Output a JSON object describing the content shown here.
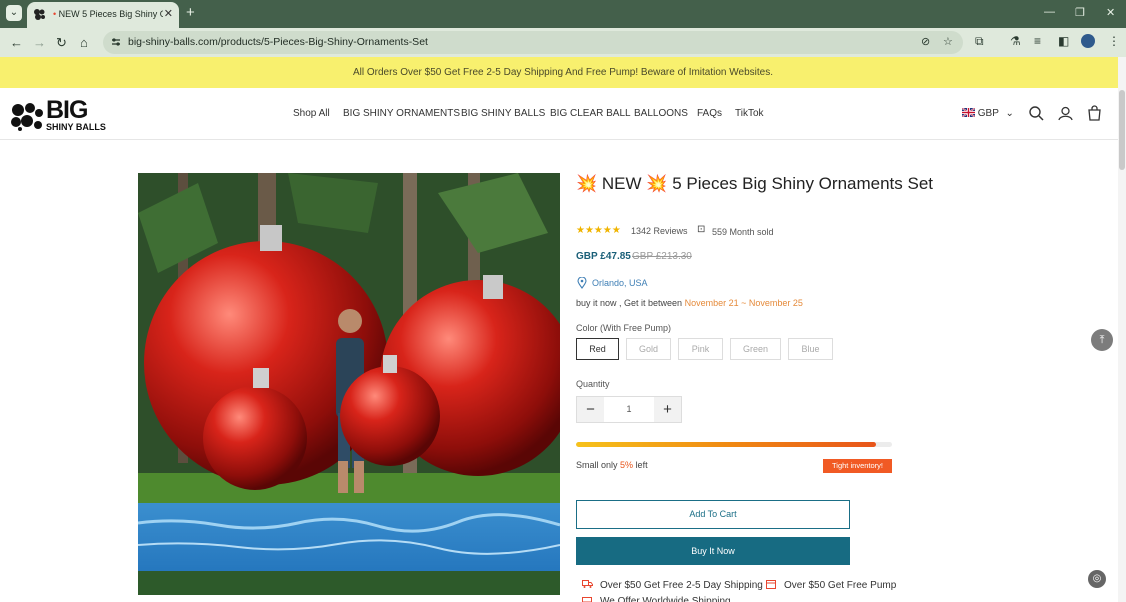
{
  "browser": {
    "tab_title": "NEW 5 Pieces Big Shiny O",
    "tab_prefix": "•",
    "url": "big-shiny-balls.com/products/5-Pieces-Big-Shiny-Ornaments-Set",
    "new_tab": "+",
    "close_tab": "✕",
    "minimize": "—",
    "maximize": "❐",
    "close_window": "✕"
  },
  "announcement": "All Orders Over $50 Get Free 2-5 Day Shipping And Free Pump! Beware of Imitation Websites.",
  "logo": {
    "big": "BIG",
    "sub": "SHINY BALLS"
  },
  "nav": [
    "Shop All",
    "BIG SHINY ORNAMENTS",
    "BIG SHINY BALLS",
    "BIG CLEAR BALL",
    "BALLOONS",
    "FAQs",
    "TikTok"
  ],
  "currency": "GBP",
  "product": {
    "burst": "💥",
    "title_mid": "NEW",
    "title_rest": "5 Pieces Big Shiny Ornaments Set",
    "rating_stars": "★★★★★",
    "rating": 5,
    "reviews": "1342 Reviews",
    "sold": "559 Month sold",
    "price": "GBP £47.85",
    "old_price": "GBP £213.30",
    "location": "Orlando, USA",
    "delivery_prefix": "buy it now ,  Get it between",
    "delivery_dates": "November 21 ~ November 25",
    "color_label": "Color (With Free Pump)",
    "colors": [
      "Red",
      "Gold",
      "Pink",
      "Green",
      "Blue"
    ],
    "selected_color": "Red",
    "quantity_label": "Quantity",
    "quantity": "1",
    "minus": "−",
    "plus": "+",
    "stock_fraction": 0.95,
    "stock_text_prefix": "Small  only",
    "stock_pct": "5%",
    "stock_suffix": "left",
    "tight_inventory": "Tight inventory!",
    "add_to_cart": "Add To Cart",
    "buy_now": "Buy It Now",
    "perks": [
      "Over $50 Get Free 2-5 Day Shipping",
      "Over $50 Get Free Pump",
      "We Offer Worldwide Shipping"
    ]
  },
  "colors": {
    "accent": "#176b82",
    "announce_bg": "#f8f06e",
    "chrome": "#44604b",
    "burst": "#e8462f",
    "sale": "#f15a24"
  }
}
